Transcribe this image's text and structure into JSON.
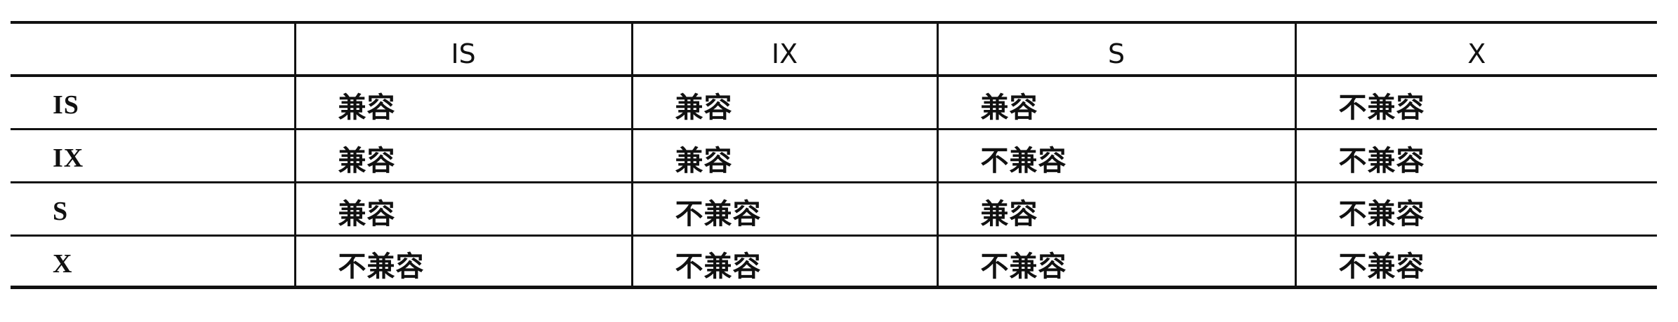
{
  "table": {
    "columns": [
      "",
      "IS",
      "IX",
      "S",
      "X"
    ],
    "rows": [
      {
        "label": "IS",
        "cells": [
          "兼容",
          "兼容",
          "兼容",
          "不兼容"
        ]
      },
      {
        "label": "IX",
        "cells": [
          "兼容",
          "兼容",
          "不兼容",
          "不兼容"
        ]
      },
      {
        "label": "S",
        "cells": [
          "兼容",
          "不兼容",
          "兼容",
          "不兼容"
        ]
      },
      {
        "label": "X",
        "cells": [
          "不兼容",
          "不兼容",
          "不兼容",
          "不兼容"
        ]
      }
    ]
  }
}
